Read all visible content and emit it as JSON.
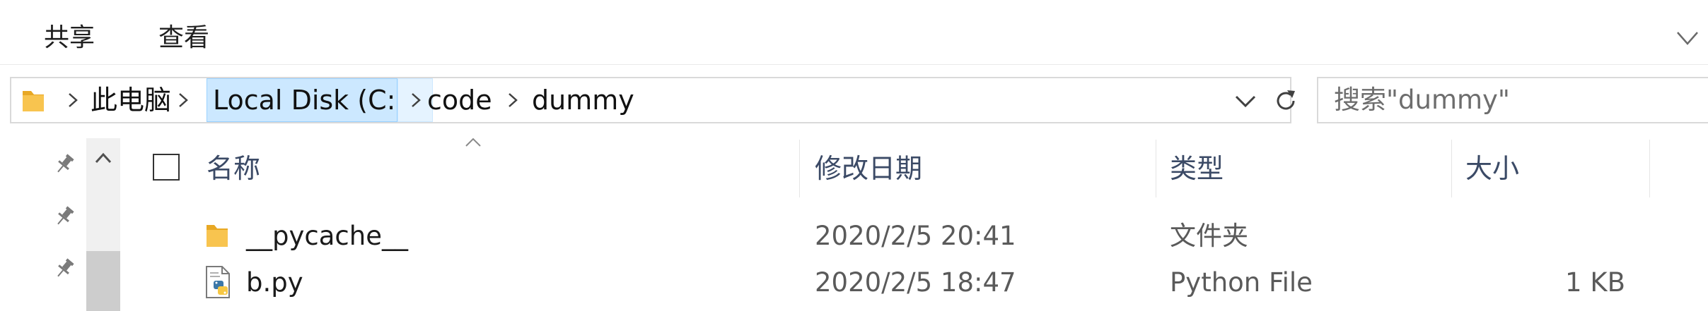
{
  "ribbon": {
    "tabs": [
      "共享",
      "查看"
    ]
  },
  "address": {
    "crumbs": [
      "此电脑",
      "Local Disk (C:)",
      "code",
      "dummy"
    ]
  },
  "search": {
    "placeholder": "搜索\"dummy\""
  },
  "columns": {
    "name": "名称",
    "modified": "修改日期",
    "type": "类型",
    "size": "大小"
  },
  "files": [
    {
      "name": "__pycache__",
      "modified": "2020/2/5 20:41",
      "type": "文件夹",
      "size": "",
      "icon": "folder-icon"
    },
    {
      "name": "b.py",
      "modified": "2020/2/5 18:47",
      "type": "Python File",
      "size": "1 KB",
      "icon": "python-file-icon"
    }
  ],
  "colors": {
    "folder": "#f8c44f",
    "crumb_highlight": "#cce8ff",
    "header_text": "#3b4a66"
  }
}
